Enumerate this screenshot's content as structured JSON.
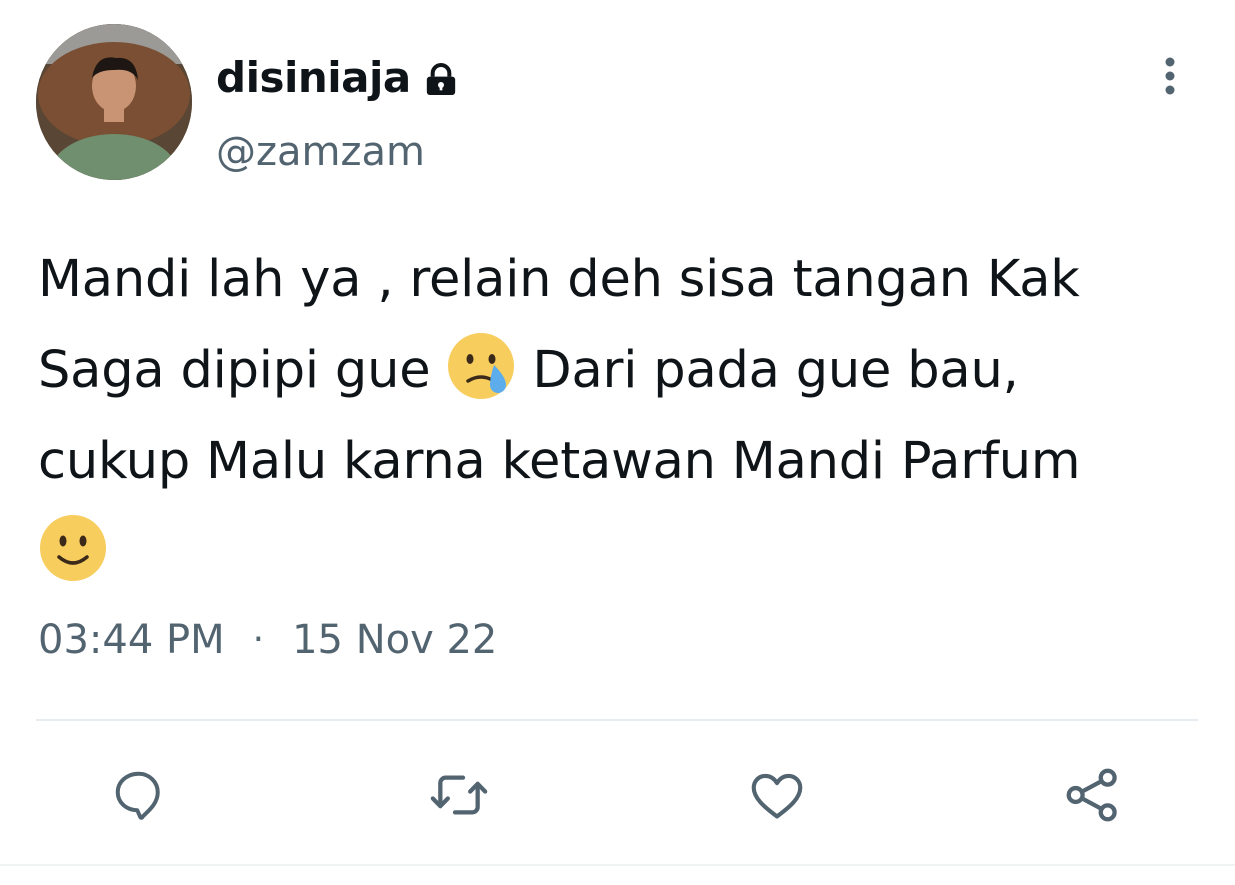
{
  "tweet": {
    "display_name": "disiniaja",
    "handle": "@zamzam",
    "protected_icon": "lock-icon",
    "text_lines": [
      "Mandi lah ya , relain deh sisa tangan Kak",
      "Saga dipipi gue",
      " Dari pada gue bau,",
      "cukup Malu karna ketawan Mandi Parfum"
    ],
    "emojis": [
      "crying-face-icon",
      "slightly-smiling-face-icon"
    ],
    "time": "03:44 PM",
    "separator": "·",
    "date": "15 Nov 22"
  },
  "actions": [
    "reply-icon",
    "retweet-icon",
    "like-icon",
    "share-icon"
  ],
  "colors": {
    "text": "#0f1419",
    "secondary": "#536471",
    "divider": "#e6ecf0",
    "emoji_yellow": "#f7cd5d",
    "tear_blue": "#5dadec"
  }
}
